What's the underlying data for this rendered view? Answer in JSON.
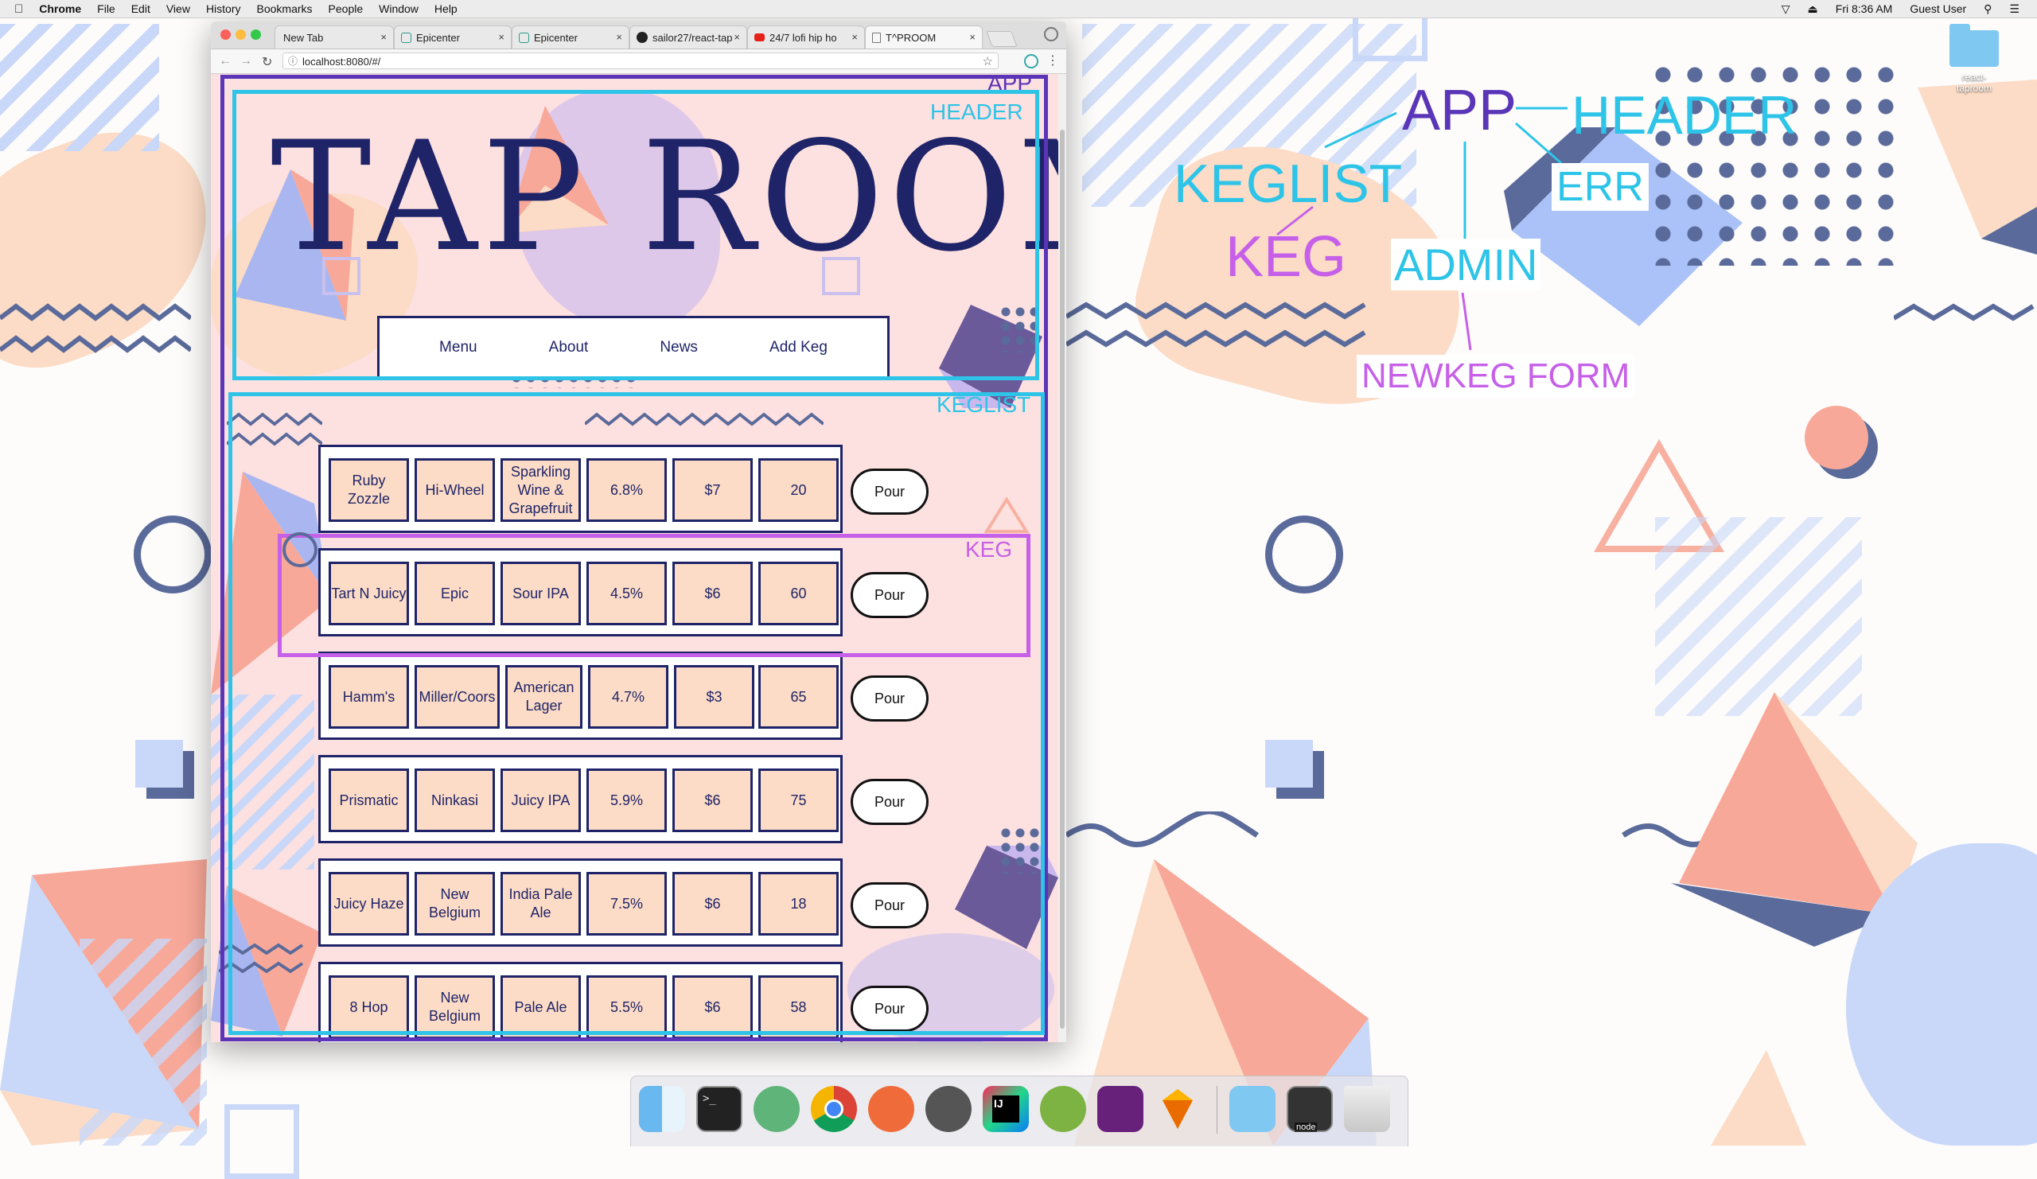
{
  "menubar": {
    "app": "Chrome",
    "items": [
      "File",
      "Edit",
      "View",
      "History",
      "Bookmarks",
      "People",
      "Window",
      "Help"
    ],
    "clock": "Fri 8:36 AM",
    "user": "Guest User"
  },
  "browser": {
    "tabs": [
      {
        "label": "New Tab",
        "icon": "blank-page-icon"
      },
      {
        "label": "Epicenter",
        "icon": "epicenter-icon"
      },
      {
        "label": "Epicenter",
        "icon": "epicenter-icon"
      },
      {
        "label": "sailor27/react-tap",
        "icon": "github-icon"
      },
      {
        "label": "24/7 lofi hip ho",
        "icon": "youtube-icon"
      },
      {
        "label": "T^PROOM",
        "icon": "page-icon"
      }
    ],
    "url": "localhost:8080/#/"
  },
  "app": {
    "title": "TAP ROOM",
    "nav": [
      "Menu",
      "About",
      "News",
      "Add Keg"
    ],
    "pour_label": "Pour",
    "kegs": [
      {
        "name": "Ruby Zozzle",
        "brand": "Hi-Wheel",
        "style": "Sparkling Wine & Grapefruit",
        "abv": "6.8%",
        "price": "$7",
        "pints": "20"
      },
      {
        "name": "Tart N Juicy",
        "brand": "Epic",
        "style": "Sour IPA",
        "abv": "4.5%",
        "price": "$6",
        "pints": "60"
      },
      {
        "name": "Hamm's",
        "brand": "Miller/Coors",
        "style": "American Lager",
        "abv": "4.7%",
        "price": "$3",
        "pints": "65"
      },
      {
        "name": "Prismatic",
        "brand": "Ninkasi",
        "style": "Juicy IPA",
        "abv": "5.9%",
        "price": "$6",
        "pints": "75"
      },
      {
        "name": "Juicy Haze",
        "brand": "New Belgium",
        "style": "India Pale Ale",
        "abv": "7.5%",
        "price": "$6",
        "pints": "18"
      },
      {
        "name": "8 Hop",
        "brand": "New Belgium",
        "style": "Pale Ale",
        "abv": "5.5%",
        "price": "$6",
        "pints": "58"
      }
    ]
  },
  "annotations": {
    "app": "APP",
    "header": "HEADER",
    "keglist": "KEGLIST",
    "keg": "KEG"
  },
  "diagram": {
    "app": "APP",
    "header": "HEADER",
    "keglist": "KEGLIST",
    "err": "ERR",
    "keg": "KEG",
    "admin": "ADMIN",
    "newkeg": "NEWKEG FORM"
  },
  "desktop": {
    "folder_label": "react-taproom",
    "dock_label": "node"
  },
  "colors": {
    "navy": "#1f2468",
    "app_box": "#5a35b8",
    "cyan": "#2ec4e8",
    "magenta": "#c660e8",
    "peach": "#fcdcc6",
    "pink_bg": "#fde0e0"
  }
}
